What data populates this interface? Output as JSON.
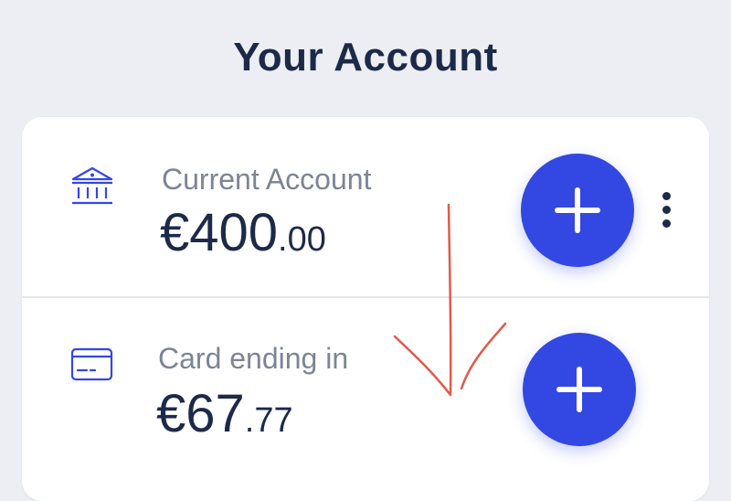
{
  "page": {
    "title": "Your Account"
  },
  "accounts": [
    {
      "label": "Current Account",
      "amount_major": "€400",
      "amount_minor": ".00",
      "icon": "bank-icon",
      "add_icon": "plus-icon"
    },
    {
      "label": "Card ending in",
      "amount_major": "€67",
      "amount_minor": ".77",
      "icon": "credit-card-icon",
      "add_icon": "plus-icon"
    }
  ],
  "menu": {
    "icon": "more-vertical-icon"
  },
  "colors": {
    "background": "#edeef3",
    "card": "#ffffff",
    "primary_text": "#1c2a4a",
    "secondary_text": "#7c8496",
    "accent": "#3347e3",
    "icon": "#3347e3",
    "annotation": "#e05a4a"
  }
}
